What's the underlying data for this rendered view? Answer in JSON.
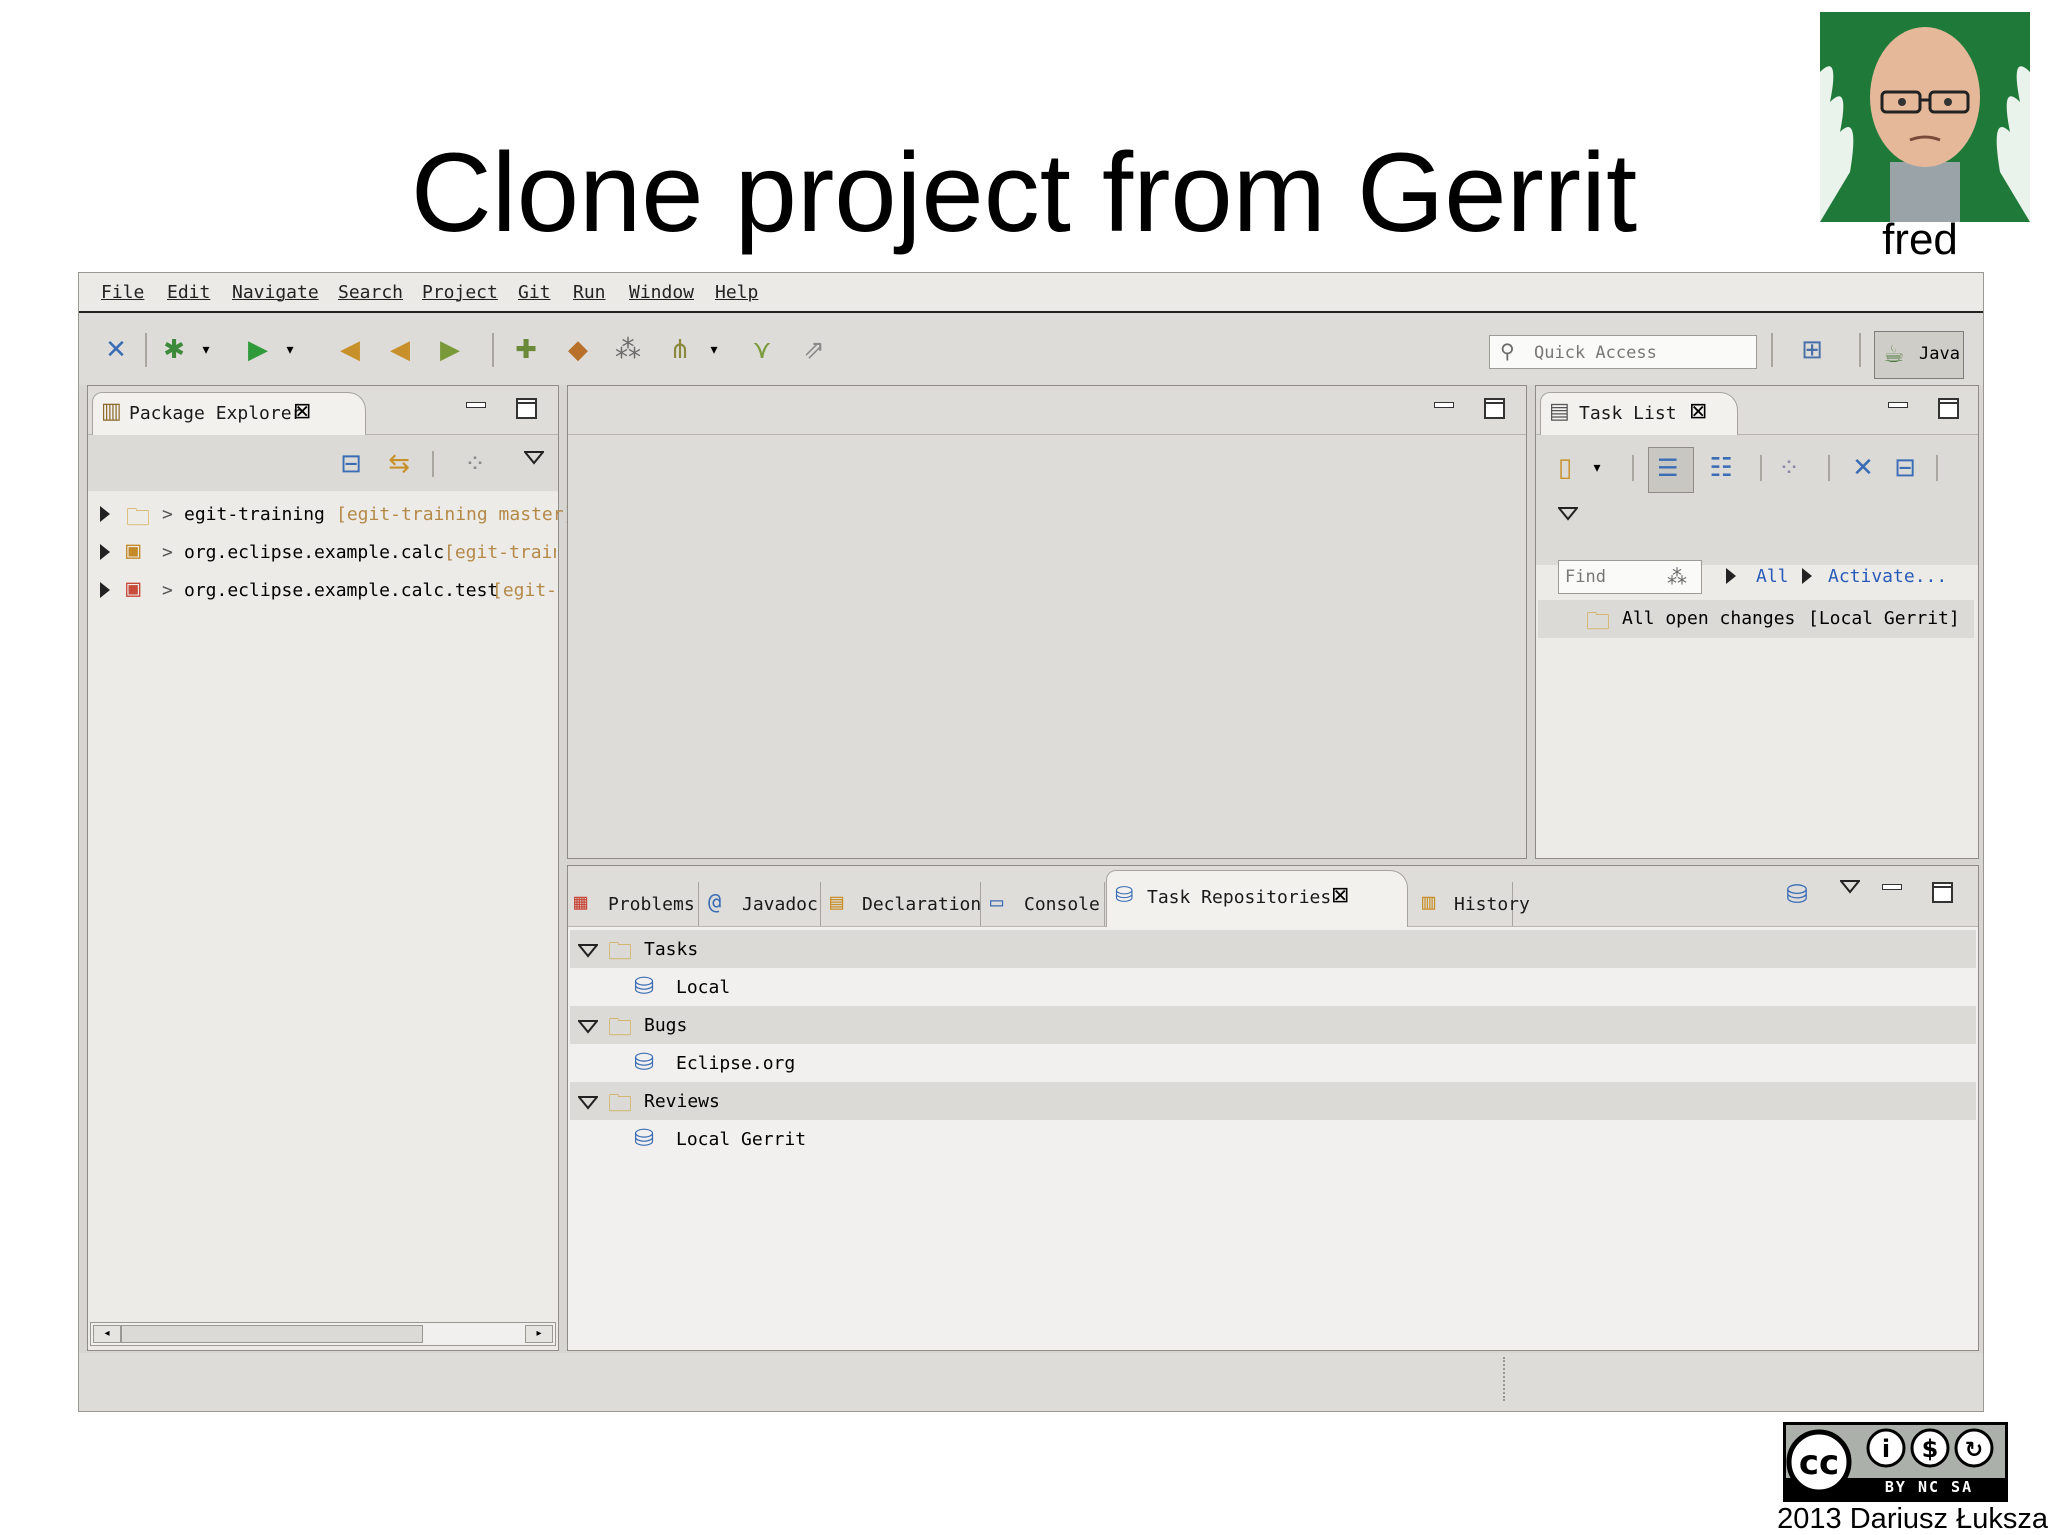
{
  "slide": {
    "title": "Clone project from Gerrit",
    "avatar_caption": "fred",
    "credit": "2013 Dariusz Łuksza",
    "license_badge": "BY NC SA"
  },
  "menubar": {
    "items": [
      "File",
      "Edit",
      "Navigate",
      "Search",
      "Project",
      "Git",
      "Run",
      "Window",
      "Help"
    ]
  },
  "toolbar": {
    "quick_access_placeholder": "Quick Access",
    "perspective_label": "Java"
  },
  "package_explorer": {
    "tab_label": "Package Explorer",
    "projects": [
      {
        "prefix": "> ",
        "name": "egit-training",
        "decoration": "[egit-training master]"
      },
      {
        "prefix": "> ",
        "name": "org.eclipse.example.calc",
        "decoration": "[egit-traini"
      },
      {
        "prefix": "> ",
        "name": "org.eclipse.example.calc.test",
        "decoration": "[egit-t"
      }
    ]
  },
  "task_list": {
    "tab_label": "Task List",
    "find_placeholder": "Find",
    "all_link": "All",
    "activate_link": "Activate...",
    "query": {
      "name": "All open changes",
      "repository": "[Local Gerrit]"
    }
  },
  "bottom_panel": {
    "tabs": [
      {
        "label": "Problems"
      },
      {
        "label": "Javadoc"
      },
      {
        "label": "Declaration"
      },
      {
        "label": "Console"
      },
      {
        "label": "Task Repositories"
      },
      {
        "label": "History"
      }
    ],
    "repositories": [
      {
        "category": "Tasks",
        "item": "Local"
      },
      {
        "category": "Bugs",
        "item": "Eclipse.org"
      },
      {
        "category": "Reviews",
        "item": "Local Gerrit"
      }
    ]
  },
  "colors": {
    "decoration": "#b58a48",
    "link": "#2a5bb8",
    "ide_bg": "#d8d6d2"
  }
}
